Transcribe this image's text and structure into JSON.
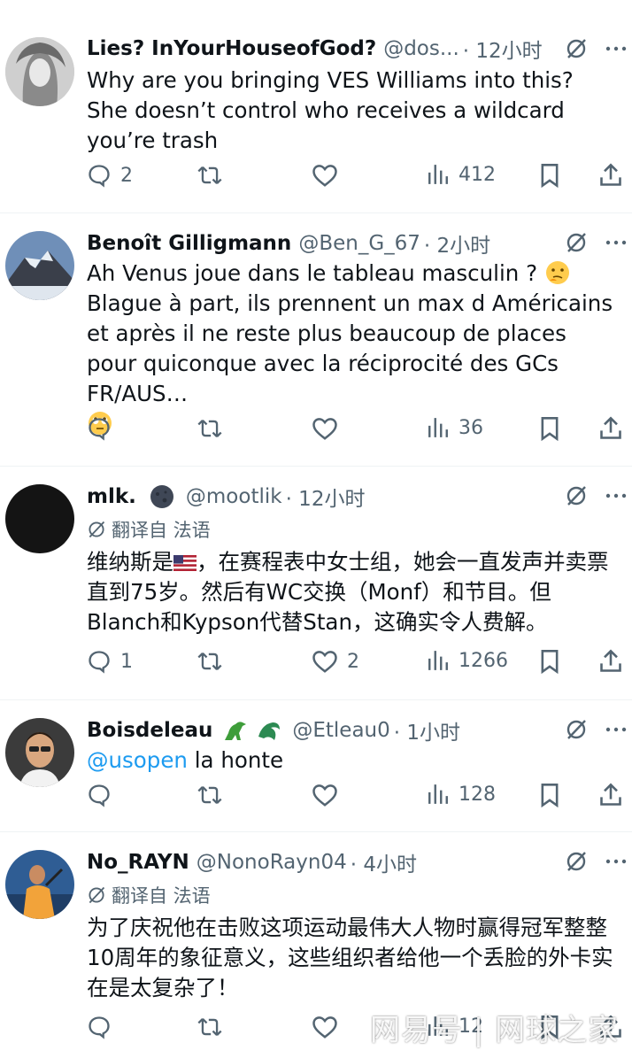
{
  "tweets": [
    {
      "name": "Lies? InYourHouseofGod?",
      "handle": "@dos...",
      "time": "· 12小时",
      "text": "Why are you bringing VES Williams into this? She doesn’t control who receives a wildcard you’re trash",
      "replies": "2",
      "retweets": "",
      "likes": "",
      "views": "412"
    },
    {
      "name": "Benoît Gilligmann",
      "handle": "@Ben_G_67",
      "time": "· 2小时",
      "text1": "Ah Venus joue dans le tableau masculin ?",
      "text2": "Blague à part, ils prennent un max d Américains et après il ne reste plus beaucoup de places pour quiconque avec la réciprocité des GCs FR/AUS…",
      "replies": "",
      "retweets": "",
      "likes": "",
      "views": "36"
    },
    {
      "name": "mlk.",
      "handle": "@mootlik",
      "time": "· 12小时",
      "translate": "翻译自 法语",
      "text1": "维纳斯是",
      "text2": "，在赛程表中女士组，她会一直发声并卖票直到75岁。然后有WC交换（Monf）和节目。但Blanch和Kypson代替Stan，这确实令人费解。",
      "replies": "1",
      "retweets": "",
      "likes": "2",
      "views": "1266"
    },
    {
      "name": "Boisdeleau",
      "handle": "@Etleau0",
      "time": "· 1小时",
      "mention": "@usopen",
      "text": " la honte",
      "replies": "",
      "retweets": "",
      "likes": "",
      "views": "128"
    },
    {
      "name": "No_RAYN",
      "handle": "@NonoRayn04",
      "time": "· 4小时",
      "translate": "翻译自 法语",
      "text": "为了庆祝他在击败这项运动最伟大人物时赢得冠军整整10周年的象征意义，这些组织者给他一个丢脸的外卡实在是太复杂了！",
      "replies": "",
      "retweets": "",
      "likes": "",
      "views": "12"
    }
  ],
  "watermark": "网易号 | 网球之家",
  "icons": [
    "reply-icon",
    "retweet-icon",
    "like-icon",
    "views-icon",
    "bookmark-icon",
    "share-icon",
    "grok-icon",
    "more-icon"
  ],
  "colors": {
    "text": "#0f1419",
    "secondary": "#536471",
    "link": "#1d9bf0",
    "divider": "#eff3f4"
  }
}
